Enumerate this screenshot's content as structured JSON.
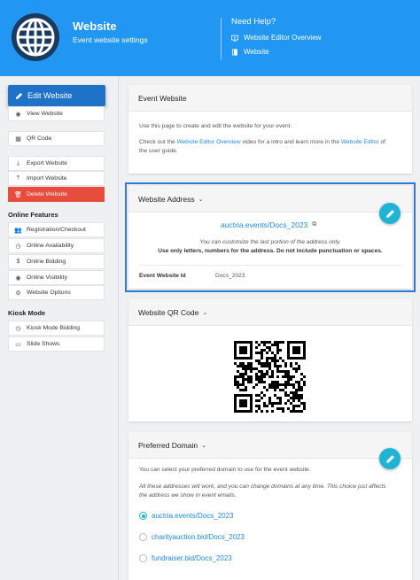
{
  "header": {
    "title": "Website",
    "subtitle": "Event website settings",
    "help_title": "Need Help?",
    "help_links": [
      "Website Editor Overview",
      "Website"
    ]
  },
  "sidebar": {
    "edit_button": "Edit Website",
    "items_top": [
      {
        "label": "View Website",
        "icon": "eye-icon"
      },
      {
        "label": "QR Code",
        "icon": "qr-code-icon"
      },
      {
        "label": "Export Website",
        "icon": "download-icon"
      },
      {
        "label": "Import Website",
        "icon": "upload-icon"
      },
      {
        "label": "Delete Website",
        "icon": "trash-icon"
      }
    ],
    "online_features_heading": "Online Features",
    "online_features": [
      {
        "label": "Registration/Checkout",
        "icon": "users-icon"
      },
      {
        "label": "Online Availability",
        "icon": "clock-icon"
      },
      {
        "label": "Online Bidding",
        "icon": "dollar-icon"
      },
      {
        "label": "Online Visibility",
        "icon": "eye-icon"
      },
      {
        "label": "Website Options",
        "icon": "gear-icon"
      }
    ],
    "kiosk_heading": "Kiosk Mode",
    "kiosk": [
      {
        "label": "Kiosk Mode Bidding",
        "icon": "clock-icon"
      },
      {
        "label": "Slide Shows",
        "icon": "slides-icon"
      }
    ]
  },
  "event_website": {
    "title": "Event Website",
    "intro": "Use this page to create and edit the website for your event.",
    "check_prefix": "Check out the",
    "overview_link": "Website Editor Overview",
    "check_middle": "video for a intro and learn more in the",
    "editor_link": "Website Editor",
    "check_suffix": "of",
    "check_line2": "the user guide."
  },
  "website_address": {
    "title": "Website Address",
    "url": "auctria.events/Docs_2023",
    "hint": "You can customize the last portion of the address only.",
    "rules": "Use only letters, numbers for the address. Do not include punctuation or spaces.",
    "id_label": "Event Website Id",
    "id_value": "Docs_2023"
  },
  "qr": {
    "title": "Website QR Code"
  },
  "preferred_domain": {
    "title": "Preferred Domain",
    "intro": "You can select your preferred domain to use for the event website.",
    "note_line1": "All these addresses will work, and you can change domains at any time. This choice just affects",
    "note_line2": "the address we show in event emails.",
    "options": [
      "auctria.events/Docs_2023",
      "charityauction.bid/Docs_2023",
      "fundraiser.bid/Docs_2023"
    ],
    "selected": "auctria.events/Docs_2023"
  },
  "colors": {
    "header": "#2196f3",
    "accent": "#1fb3d6",
    "danger": "#e74c3c",
    "link": "#1e88e5"
  }
}
